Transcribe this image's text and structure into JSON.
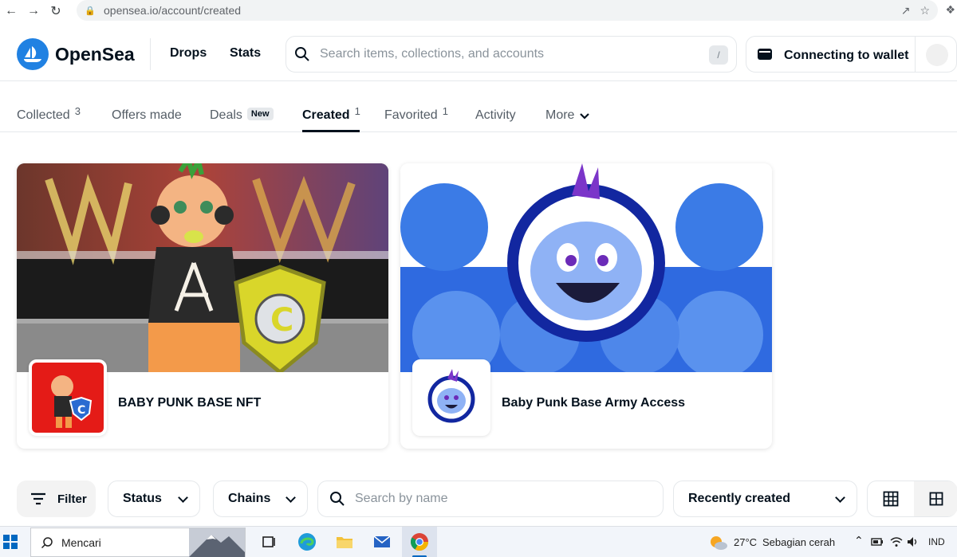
{
  "browser": {
    "url": "opensea.io/account/created"
  },
  "header": {
    "brand": "OpenSea",
    "nav": [
      "Drops",
      "Stats"
    ],
    "search_placeholder": "Search items, collections, and accounts",
    "search_shortcut": "/",
    "wallet_label": "Connecting to wallet"
  },
  "tabs": [
    {
      "label": "Collected",
      "count": "3"
    },
    {
      "label": "Offers made",
      "count": ""
    },
    {
      "label": "Deals",
      "badge": "New"
    },
    {
      "label": "Created",
      "count": "1",
      "active": true
    },
    {
      "label": "Favorited",
      "count": "1"
    },
    {
      "label": "Activity",
      "count": ""
    },
    {
      "label": "More"
    }
  ],
  "collections": [
    {
      "name": "BABY PUNK BASE NFT"
    },
    {
      "name": "Baby Punk Base Army Access"
    }
  ],
  "filters": {
    "filter_label": "Filter",
    "status_label": "Status",
    "chains_label": "Chains",
    "search_placeholder": "Search by name",
    "sort_label": "Recently created"
  },
  "taskbar": {
    "search_placeholder": "Mencari",
    "temperature": "27°C",
    "weather": "Sebagian cerah",
    "language": "IND"
  },
  "colors": {
    "brand_blue": "#2081e2",
    "text_primary": "#04111d",
    "border": "#e5e8eb"
  }
}
